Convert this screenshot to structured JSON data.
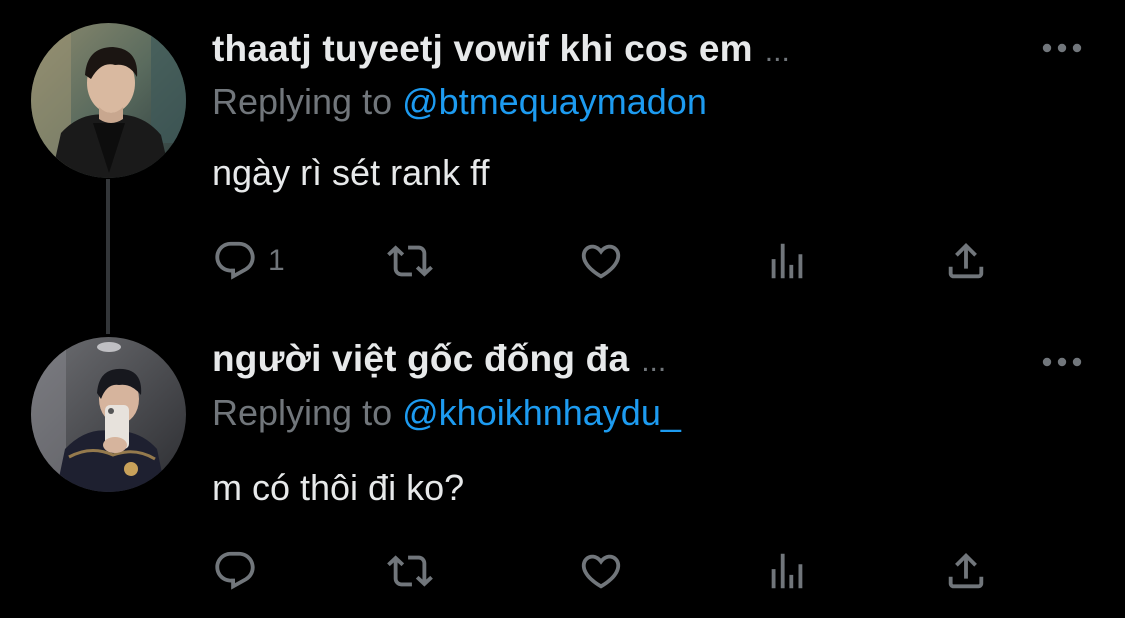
{
  "tweets": [
    {
      "display_name": "thaatj tuyeetj vowif khi cos em",
      "name_ellipsis": "...",
      "replying_prefix": "Replying to",
      "replying_handle": "@btmequaymadon",
      "text": "ngày rì sét rank ff",
      "reply_count": "1",
      "icons": [
        "reply-icon",
        "retweet-icon",
        "like-icon",
        "views-icon",
        "share-icon",
        "more-icon"
      ]
    },
    {
      "display_name": "người việt gốc đống đa",
      "name_ellipsis": "...",
      "replying_prefix": "Replying to",
      "replying_handle": "@khoikhnhaydu_",
      "text": "m có thôi đi ko?",
      "reply_count": "",
      "icons": [
        "reply-icon",
        "retweet-icon",
        "like-icon",
        "views-icon",
        "share-icon",
        "more-icon"
      ]
    }
  ],
  "colors": {
    "background": "#000000",
    "primary_text": "#E7E9EA",
    "secondary_text": "#71767B",
    "link": "#1D9BF0",
    "thread_line": "#333639"
  }
}
